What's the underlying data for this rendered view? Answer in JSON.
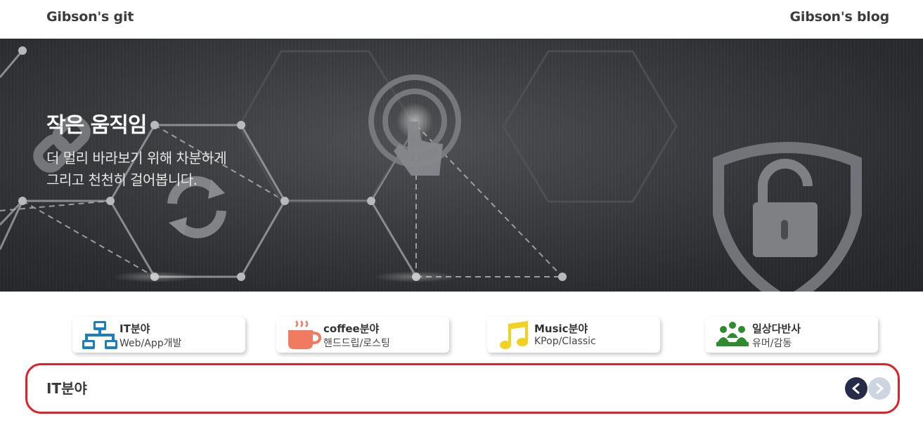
{
  "header": {
    "left_link": "Gibson's git",
    "right_link": "Gibson's blog"
  },
  "hero": {
    "title": "작은 움직임",
    "subtitle_lines": [
      "더 멀리 바라보기 위해 차분하게",
      "그리고 천천히 걸어봅니다."
    ]
  },
  "categories": [
    {
      "title": "IT분야",
      "subtitle": "Web/App개발",
      "icon": "network-icon",
      "color": "#1a7fc1"
    },
    {
      "title": "coffee분야",
      "subtitle": "핸드드립/로스팅",
      "icon": "coffee-cup-icon",
      "color": "#f07b60"
    },
    {
      "title": "Music분야",
      "subtitle": "KPop/Classic",
      "icon": "music-note-icon",
      "color": "#f2d21f"
    },
    {
      "title": "일상다반사",
      "subtitle": "유머/감동",
      "icon": "people-group-icon",
      "color": "#2e8b2e"
    }
  ],
  "section": {
    "title": "IT분야",
    "prev_icon": "chevron-left-icon",
    "next_icon": "chevron-right-icon",
    "prev_color": "#262b4a",
    "next_color": "#cdd6e0"
  }
}
